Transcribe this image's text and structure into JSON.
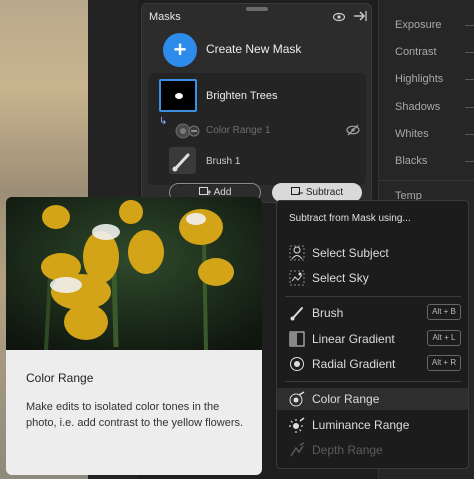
{
  "masks_panel": {
    "title": "Masks",
    "create_new_mask": "Create New Mask",
    "mask_name": "Brighten Trees",
    "components": [
      {
        "label": "Color Range 1"
      },
      {
        "label": "Brush 1"
      }
    ],
    "add_label": "Add",
    "subtract_label": "Subtract"
  },
  "adjust_panel": {
    "items": [
      "Exposure",
      "Contrast",
      "Highlights",
      "Shadows",
      "Whites",
      "Blacks",
      "Temp"
    ]
  },
  "menu": {
    "heading": "Subtract from Mask using...",
    "items": [
      {
        "label": "Select Subject",
        "icon": "select-subject-icon"
      },
      {
        "label": "Select Sky",
        "icon": "select-sky-icon"
      },
      {
        "label": "Brush",
        "icon": "brush-icon",
        "shortcut": "Alt + B"
      },
      {
        "label": "Linear Gradient",
        "icon": "linear-gradient-icon",
        "shortcut": "Alt + L"
      },
      {
        "label": "Radial Gradient",
        "icon": "radial-gradient-icon",
        "shortcut": "Alt + R"
      },
      {
        "label": "Color Range",
        "icon": "color-range-icon",
        "highlighted": true
      },
      {
        "label": "Luminance Range",
        "icon": "luminance-range-icon"
      },
      {
        "label": "Depth Range",
        "icon": "depth-range-icon",
        "disabled": true
      }
    ]
  },
  "tooltip": {
    "title": "Color Range",
    "description": "Make edits to isolated color tones in the photo, i.e. add contrast to the yellow flowers."
  },
  "colors": {
    "accent": "#2d8ceb",
    "panel": "#2c2c2c",
    "menu": "#1c1c1c"
  }
}
